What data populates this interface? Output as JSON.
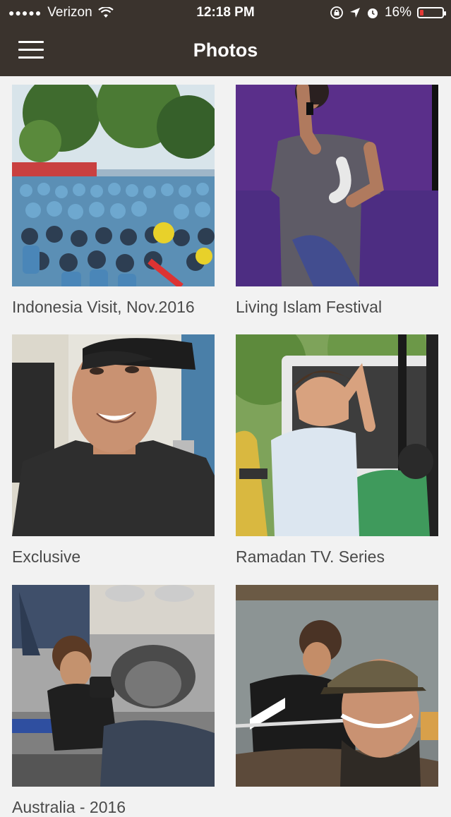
{
  "status_bar": {
    "signal_dots": "●●●●●",
    "carrier": "Verizon",
    "time": "12:18 PM",
    "battery": "16%"
  },
  "header": {
    "title": "Photos"
  },
  "albums": [
    {
      "caption": "Indonesia Visit, Nov.2016"
    },
    {
      "caption": "Living Islam Festival"
    },
    {
      "caption": "Exclusive"
    },
    {
      "caption": "Ramadan TV. Series"
    },
    {
      "caption": "Australia - 2016"
    },
    {
      "caption": ""
    }
  ],
  "colors": {
    "header_bg": "#3a332d",
    "page_bg": "#f2f2f2",
    "caption_text": "#4a4a4a",
    "battery_low": "#e53935"
  }
}
